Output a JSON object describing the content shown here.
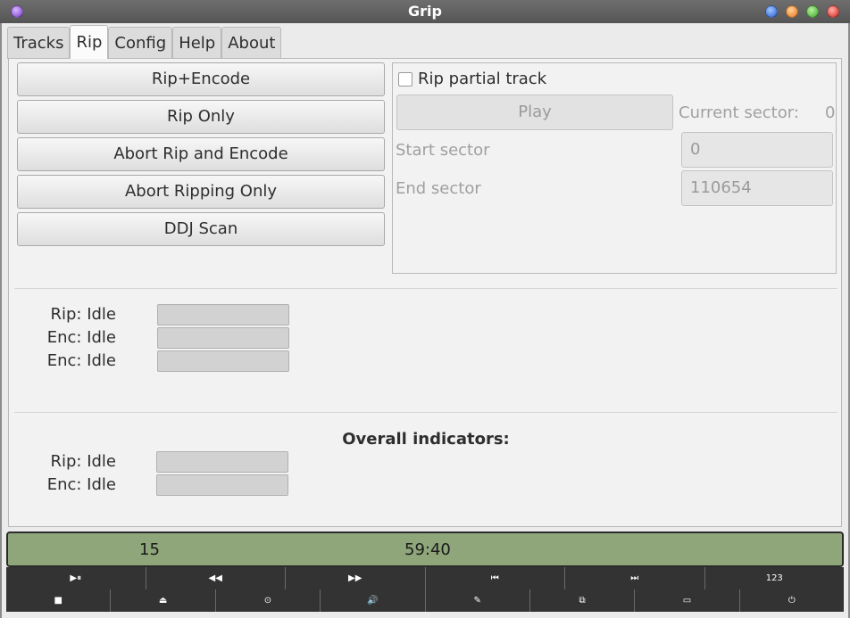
{
  "window": {
    "title": "Grip"
  },
  "tabs": [
    "Tracks",
    "Rip",
    "Config",
    "Help",
    "About"
  ],
  "active_tab": "Rip",
  "rip_buttons": [
    "Rip+Encode",
    "Rip Only",
    "Abort Rip and Encode",
    "Abort Ripping Only",
    "DDJ Scan"
  ],
  "partial": {
    "checkbox_label": "Rip partial track",
    "checked": false,
    "play_label": "Play",
    "current_sector_label": "Current sector:",
    "current_sector_value": "0",
    "start_sector_label": "Start sector",
    "start_sector_value": "0",
    "end_sector_label": "End sector",
    "end_sector_value": "110654"
  },
  "status": {
    "rip": "Rip: Idle",
    "enc1": "Enc: Idle",
    "enc2": "Enc: Idle"
  },
  "overall": {
    "heading": "Overall indicators:",
    "rip": "Rip: Idle",
    "enc": "Enc: Idle"
  },
  "lcd": {
    "track": "15",
    "time": "59:40",
    "color": "#8ea679"
  },
  "controls_row1": [
    {
      "icon": "play-pause-icon",
      "glyph": "▶⏸"
    },
    {
      "icon": "rewind-icon",
      "glyph": "◀◀"
    },
    {
      "icon": "fast-forward-icon",
      "glyph": "▶▶"
    },
    {
      "icon": "previous-track-icon",
      "glyph": "⏮"
    },
    {
      "icon": "next-track-icon",
      "glyph": "⏭"
    },
    {
      "icon": "track-numbers-icon",
      "glyph": "123"
    }
  ],
  "controls_row2": [
    {
      "icon": "stop-icon",
      "glyph": "■"
    },
    {
      "icon": "eject-icon",
      "glyph": "⏏"
    },
    {
      "icon": "cd-scan-icon",
      "glyph": "⊙"
    },
    {
      "icon": "volume-icon",
      "glyph": "🔊"
    },
    {
      "icon": "edit-icon",
      "glyph": "✎"
    },
    {
      "icon": "network-icon",
      "glyph": "⧉"
    },
    {
      "icon": "window-icon",
      "glyph": "▭"
    },
    {
      "icon": "power-icon",
      "glyph": "⏻"
    }
  ]
}
